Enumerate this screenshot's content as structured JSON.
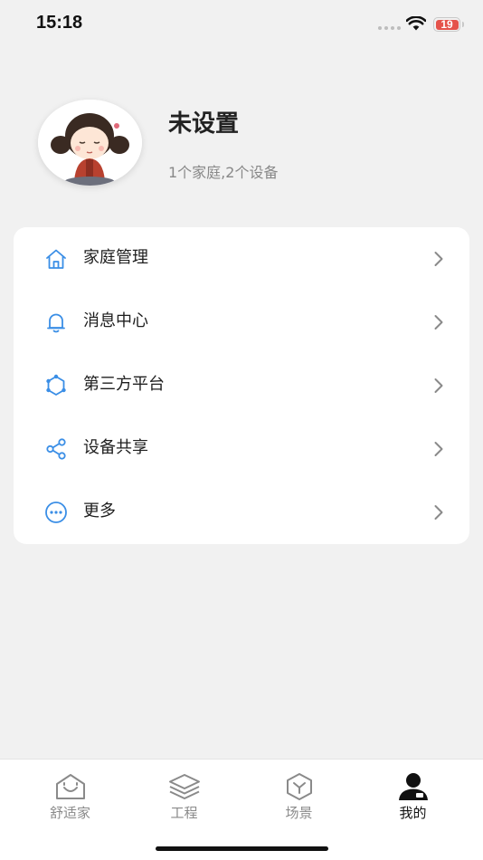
{
  "status_bar": {
    "time": "15:18",
    "battery_level": "19"
  },
  "profile": {
    "name": "未设置",
    "summary": "1个家庭,2个设备"
  },
  "menu": [
    {
      "label": "家庭管理",
      "icon": "home-icon"
    },
    {
      "label": "消息中心",
      "icon": "bell-icon"
    },
    {
      "label": "第三方平台",
      "icon": "platform-icon"
    },
    {
      "label": "设备共享",
      "icon": "share-icon"
    },
    {
      "label": "更多",
      "icon": "more-icon"
    }
  ],
  "tab_bar": {
    "tabs": [
      {
        "label": "舒适家",
        "icon": "smile-house-icon",
        "active": false
      },
      {
        "label": "工程",
        "icon": "layers-icon",
        "active": false
      },
      {
        "label": "场景",
        "icon": "cube-icon",
        "active": false
      },
      {
        "label": "我的",
        "icon": "user-icon",
        "active": true
      }
    ]
  },
  "colors": {
    "accent_blue": "#3a8ee6",
    "battery_red": "#e5534b",
    "background": "#f1f1f1"
  }
}
